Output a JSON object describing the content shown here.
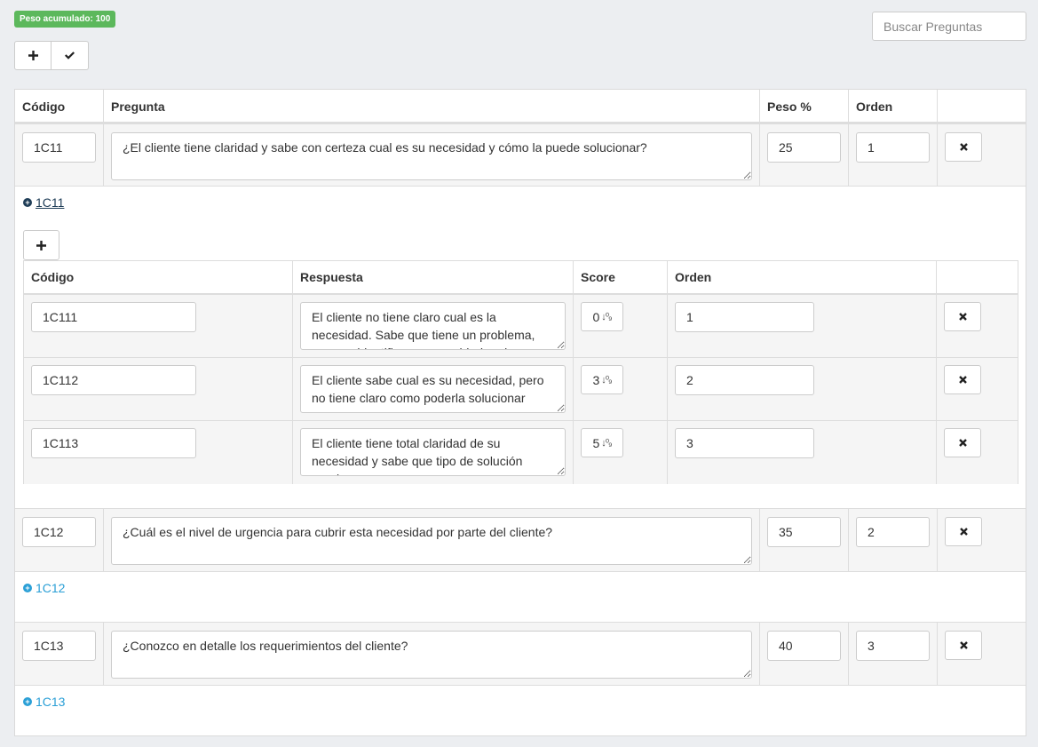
{
  "badge": {
    "text": "Peso acumulado: 100",
    "color": "#5cb85c"
  },
  "search": {
    "placeholder": "Buscar Preguntas"
  },
  "toolbar": {
    "add_icon": "plus-icon",
    "confirm_icon": "check-icon"
  },
  "questions_table": {
    "headers": {
      "code": "Código",
      "question": "Pregunta",
      "weight": "Peso %",
      "order": "Orden"
    }
  },
  "questions": [
    {
      "code": "1C11",
      "text": "¿El cliente tiene claridad y sabe con certeza cual es su necesidad y cómo la puede solucionar?",
      "weight": "25",
      "order": "1",
      "link_text": "1C11",
      "expanded": true
    },
    {
      "code": "1C12",
      "text": "¿Cuál es el nivel de urgencia para cubrir esta necesidad por parte del cliente?",
      "weight": "35",
      "order": "2",
      "link_text": "1C12",
      "expanded": false
    },
    {
      "code": "1C13",
      "text": "¿Conozco en detalle los requerimientos del cliente?",
      "weight": "40",
      "order": "3",
      "link_text": "1C13",
      "expanded": false
    }
  ],
  "answers_table": {
    "headers": {
      "code": "Código",
      "answer": "Respuesta",
      "score": "Score",
      "order": "Orden"
    }
  },
  "answers": [
    {
      "code": "1C111",
      "text": "El cliente no tiene claro cual es la necesidad. Sabe que tiene un problema, pero no identifica su necesidad real",
      "score": "0",
      "order": "1"
    },
    {
      "code": "1C112",
      "text": "El cliente sabe cual es su necesidad, pero no tiene claro como poderla solucionar",
      "score": "3",
      "order": "2"
    },
    {
      "code": "1C113",
      "text": "El cliente tiene total claridad de su necesidad y sabe que tipo de solución requiere",
      "score": "5",
      "order": "3"
    }
  ],
  "colors": {
    "link": "#2a9fd6",
    "link_active": "#1f3d57",
    "band": "#f5f5f5",
    "page": "#eceef1"
  }
}
